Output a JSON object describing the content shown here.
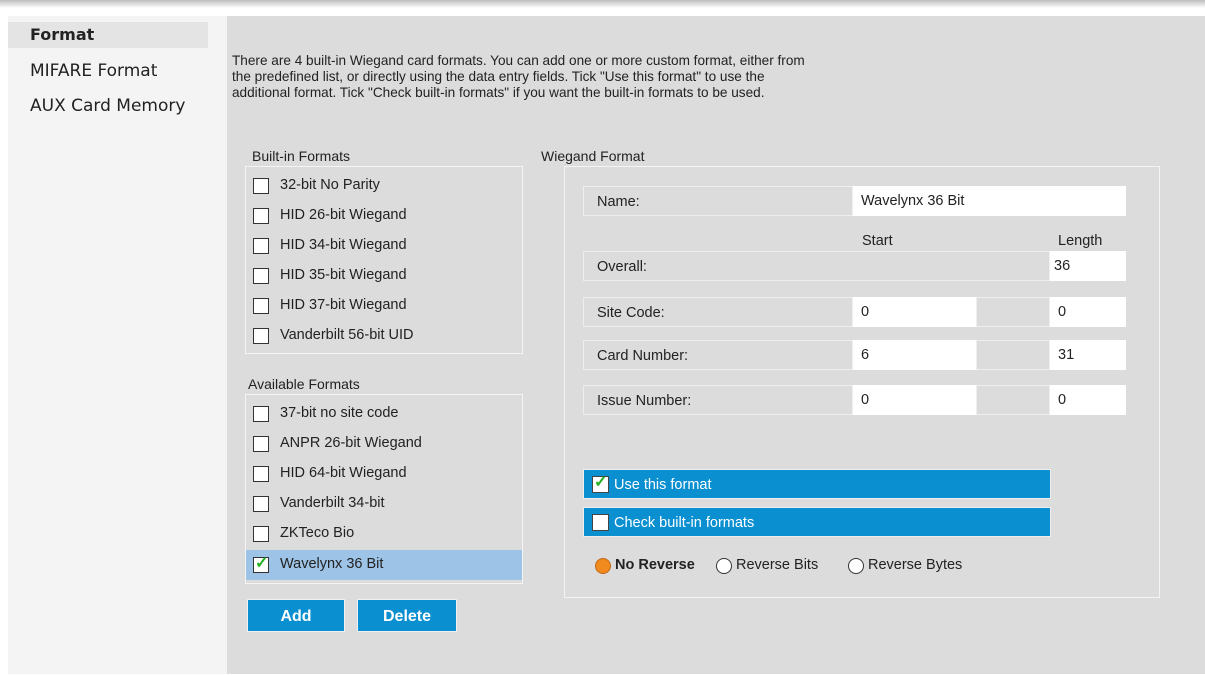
{
  "sidebar": {
    "items": [
      {
        "label": "Format",
        "active": true
      },
      {
        "label": "MIFARE Format",
        "active": false
      },
      {
        "label": "AUX Card Memory",
        "active": false
      }
    ]
  },
  "intro_lines": [
    "There are 4 built-in Wiegand card formats. You can add one or more custom format, either from",
    "the predefined list, or directly using the data entry fields. Tick \"Use this format\" to use the",
    "additional format. Tick \"Check built-in formats\" if you want the built-in formats to be used."
  ],
  "builtin": {
    "title": "Built-in Formats",
    "items": [
      {
        "label": "32-bit No Parity",
        "checked": false
      },
      {
        "label": "HID 26-bit Wiegand",
        "checked": false
      },
      {
        "label": "HID 34-bit Wiegand",
        "checked": false
      },
      {
        "label": "HID 35-bit Wiegand",
        "checked": false
      },
      {
        "label": "HID 37-bit Wiegand",
        "checked": false
      },
      {
        "label": "Vanderbilt 56-bit UID",
        "checked": false
      }
    ]
  },
  "available": {
    "title": "Available Formats",
    "items": [
      {
        "label": "37-bit no site code",
        "checked": false,
        "selected": false
      },
      {
        "label": "ANPR 26-bit Wiegand",
        "checked": false,
        "selected": false
      },
      {
        "label": "HID 64-bit Wiegand",
        "checked": false,
        "selected": false
      },
      {
        "label": "Vanderbilt 34-bit",
        "checked": false,
        "selected": false
      },
      {
        "label": "ZKTeco Bio",
        "checked": false,
        "selected": false
      },
      {
        "label": "Wavelynx 36 Bit",
        "checked": true,
        "selected": true
      }
    ]
  },
  "buttons": {
    "add": "Add",
    "delete": "Delete"
  },
  "wiegand": {
    "title": "Wiegand Format",
    "name_label": "Name:",
    "name_value": "Wavelynx 36 Bit",
    "start_header": "Start",
    "length_header": "Length",
    "overall_label": "Overall:",
    "overall_length": "36",
    "site_code_label": "Site Code:",
    "site_code_start": "0",
    "site_code_length": "0",
    "card_number_label": "Card Number:",
    "card_number_start": "6",
    "card_number_length": "31",
    "issue_number_label": "Issue Number:",
    "issue_number_start": "0",
    "issue_number_length": "0",
    "use_this_format": {
      "label": "Use this format",
      "checked": true
    },
    "check_builtin": {
      "label": "Check built-in formats",
      "checked": false
    },
    "reverse": {
      "options": [
        "No Reverse",
        "Reverse Bits",
        "Reverse Bytes"
      ],
      "selected": "No Reverse"
    }
  },
  "colors": {
    "accent": "#0a8fd0",
    "selected_row": "#9dc3e6",
    "radio_on": "#f08a1e",
    "check": "#22b022"
  }
}
